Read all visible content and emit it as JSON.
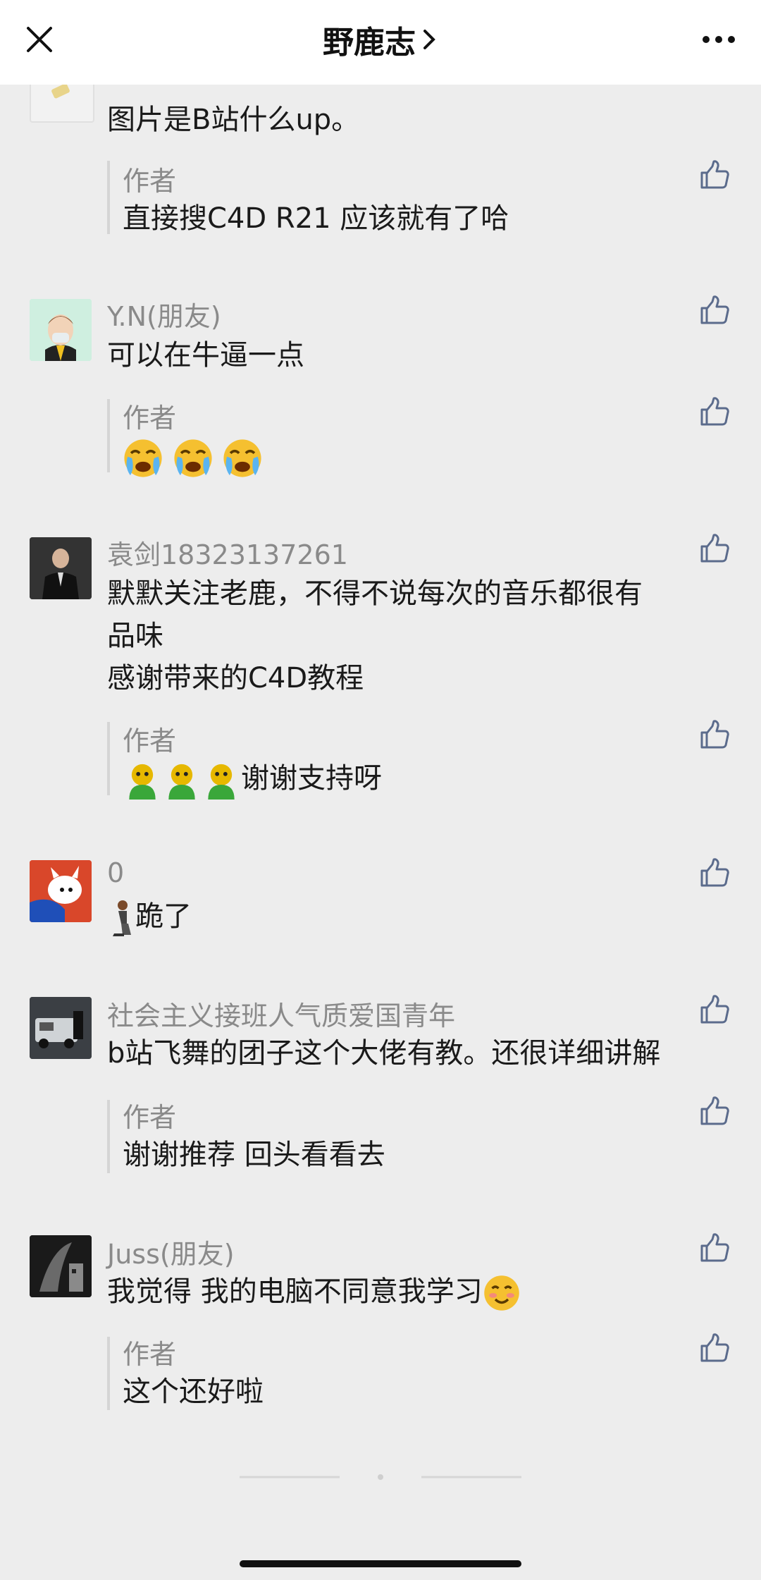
{
  "header": {
    "title": "野鹿志"
  },
  "comments": [
    {
      "text": "图片是B站什么up。",
      "reply": {
        "author": "作者",
        "text": "直接搜C4D R21 应该就有了哈"
      }
    },
    {
      "name": "Y.N(朋友)",
      "text": "可以在牛逼一点",
      "reply": {
        "author": "作者",
        "text": ""
      }
    },
    {
      "name": "袁剑18323137261",
      "text_lines": [
        "默默关注老鹿，不得不说每次的音乐都很有",
        "品味",
        "感谢带来的C4D教程"
      ],
      "reply": {
        "author": "作者",
        "text": "谢谢支持呀"
      }
    },
    {
      "name": "0",
      "text": "跪了"
    },
    {
      "name": "社会主义接班人气质爱国青年",
      "text": "b站飞舞的团子这个大佬有教。还很详细讲解",
      "reply": {
        "author": "作者",
        "text": "谢谢推荐 回头看看去"
      }
    },
    {
      "name": "Juss(朋友)",
      "text": "我觉得 我的电脑不同意我学习",
      "reply": {
        "author": "作者",
        "text": "这个还好啦"
      }
    }
  ]
}
